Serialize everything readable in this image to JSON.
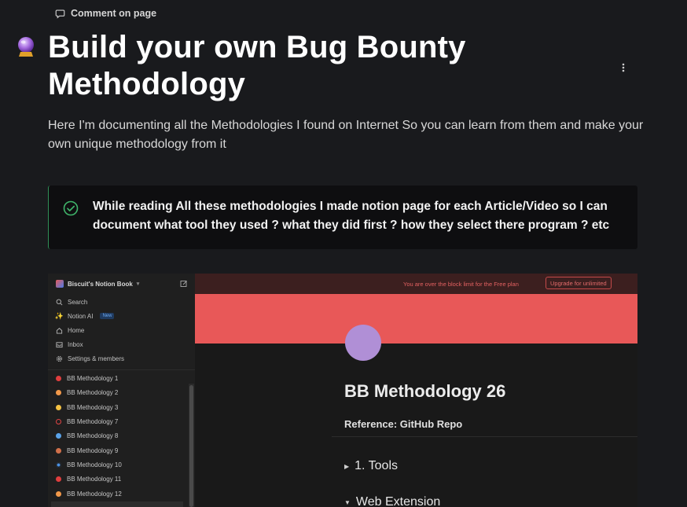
{
  "header": {
    "comment_label": "Comment on page"
  },
  "page": {
    "icon": "crystal-ball-icon",
    "title": "Build your own Bug Bounty Methodology",
    "description": "Here I'm documenting all the Methodologies I found on Internet So you can learn from them and make your own unique methodology from it"
  },
  "callout": {
    "icon": "check-circle-icon",
    "text": "While reading All these methodologies I made notion page for each Article/Video so I can document what tool they used ? what they did first ? how they select there program ? etc"
  },
  "embed": {
    "sidebar": {
      "workspace": "Biscuit's Notion Book",
      "nav": [
        {
          "label": "Search",
          "icon": "search-icon"
        },
        {
          "label": "Notion AI",
          "icon": "sparkle-icon",
          "badge": "New"
        },
        {
          "label": "Home",
          "icon": "home-icon"
        },
        {
          "label": "Inbox",
          "icon": "inbox-icon"
        },
        {
          "label": "Settings & members",
          "icon": "gear-icon"
        }
      ],
      "pages": [
        {
          "label": "BB Methodology 1",
          "color": "#e03e3e"
        },
        {
          "label": "BB Methodology 2",
          "color": "#f2994a"
        },
        {
          "label": "BB Methodology 3",
          "color": "#f5c242"
        },
        {
          "label": "BB Methodology 7",
          "color": "#e03e3e",
          "ring": true
        },
        {
          "label": "BB Methodology 8",
          "color": "#5aa2e8"
        },
        {
          "label": "BB Methodology 9",
          "color": "#d0704a"
        },
        {
          "label": "BB Methodology 10",
          "color": "#4a90e2"
        },
        {
          "label": "BB Methodology 11",
          "color": "#e03e3e"
        },
        {
          "label": "BB Methodology 12",
          "color": "#f2994a"
        }
      ]
    },
    "banner": {
      "text": "You are over the block limit for the Free plan",
      "upgrade_label": "Upgrade for unlimited"
    },
    "page": {
      "title": "BB Methodology 26",
      "reference": "Reference: GitHub Repo",
      "toggles": [
        "1. Tools",
        "Web Extension"
      ]
    }
  },
  "colors": {
    "background": "#191a1d",
    "callout_border": "#2f8f57",
    "cover": "#e85858",
    "avatar": "#b08fd6"
  }
}
